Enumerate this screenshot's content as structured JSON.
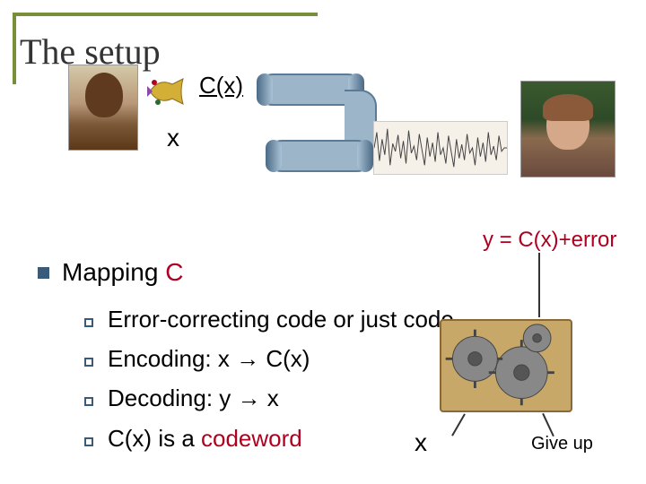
{
  "title": "The setup",
  "labels": {
    "cx": "C(x)",
    "x": "x",
    "y_eq": "y = C(x)+error",
    "x_out": "x",
    "give_up": "Give up"
  },
  "mapping": {
    "prefix": "Mapping ",
    "c": "C"
  },
  "bullets": [
    {
      "text": "Error-correcting code or just code"
    },
    {
      "prefix": "Encoding: x ",
      "arrow": "→",
      "suffix": " C(x)"
    },
    {
      "prefix": "Decoding: y ",
      "arrow": "→",
      "suffix": " x"
    },
    {
      "prefix": "C(x) is a ",
      "codeword": "codeword"
    }
  ]
}
